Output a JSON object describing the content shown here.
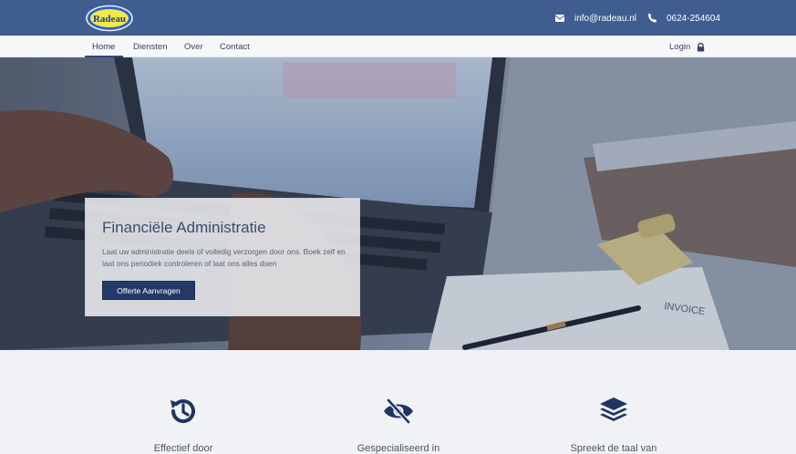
{
  "header": {
    "logo_text": "Radeau",
    "email": "info@radeau.nl",
    "phone": "0624-254604"
  },
  "nav": {
    "items": [
      "Home",
      "Diensten",
      "Over",
      "Contact"
    ],
    "active": "Home",
    "login_label": "Login"
  },
  "hero": {
    "title": "Financiële Administratie",
    "text": "Laat uw administratie deels of volledig verzorgen door ons. Boek zelf en laat ons periodiek controleren of laat ons alles doen",
    "button_label": "Offerte Aanvragen",
    "invoice_text": "INVOICE"
  },
  "features": [
    {
      "icon": "history-icon",
      "label": "Effectief door"
    },
    {
      "icon": "eye-slash-icon",
      "label": "Gespecialiseerd in"
    },
    {
      "icon": "layers-icon",
      "label": "Spreekt de taal van"
    }
  ],
  "colors": {
    "header_bg": "#3f5e8f",
    "button_bg": "#233a68",
    "icon_color": "#1f3561"
  }
}
